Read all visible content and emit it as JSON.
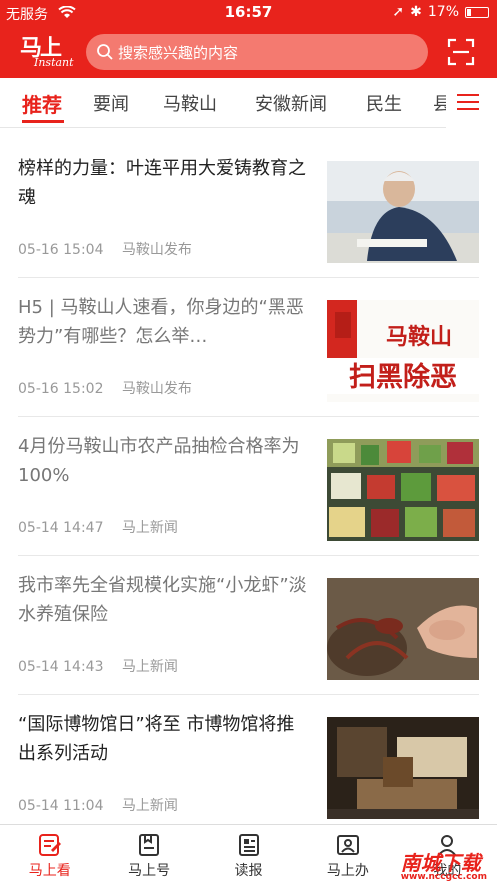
{
  "status": {
    "carrier": "无服务",
    "time": "16:57",
    "battery": "17%",
    "battery_level": 0.17
  },
  "header": {
    "logo_main": "马上",
    "logo_sub": "Instant",
    "search_placeholder": "搜索感兴趣的内容"
  },
  "tabs": [
    {
      "label": "推荐"
    },
    {
      "label": "要闻"
    },
    {
      "label": "马鞍山"
    },
    {
      "label": "安徽新闻"
    },
    {
      "label": "民生"
    },
    {
      "label": "县"
    }
  ],
  "articles": [
    {
      "title": "榜样的力量：叶连平用大爱铸教育之魂",
      "date": "05-16 15:04",
      "source": "马鞍山发布",
      "read": false
    },
    {
      "title": "H5 | 马鞍山人速看，你身边的“黑恶势力”有哪些？怎么举…",
      "date": "05-16 15:02",
      "source": "马鞍山发布",
      "read": true,
      "thumb_text_top": "马鞍山",
      "thumb_text_bottom": "扫黑除恶"
    },
    {
      "title": "4月份马鞍山市农产品抽检合格率为100%",
      "date": "05-14 14:47",
      "source": "马上新闻",
      "read": true
    },
    {
      "title": "我市率先全省规模化实施“小龙虾”淡水养殖保险",
      "date": "05-14 14:43",
      "source": "马上新闻",
      "read": true
    },
    {
      "title": "“国际博物馆日”将至 市博物馆将推出系列活动",
      "date": "05-14 11:04",
      "source": "马上新闻",
      "read": false
    }
  ],
  "bottom_nav": [
    {
      "label": "马上看",
      "icon": "news-icon",
      "active": true
    },
    {
      "label": "马上号",
      "icon": "account-icon",
      "active": false
    },
    {
      "label": "读报",
      "icon": "newspaper-icon",
      "active": false
    },
    {
      "label": "马上办",
      "icon": "service-icon",
      "active": false
    },
    {
      "label": "我的",
      "icon": "user-icon",
      "active": false
    }
  ],
  "watermark": {
    "main": "南城下载",
    "sub": "www.nccgcc.com"
  },
  "colors": {
    "brand": "#e8231c"
  }
}
